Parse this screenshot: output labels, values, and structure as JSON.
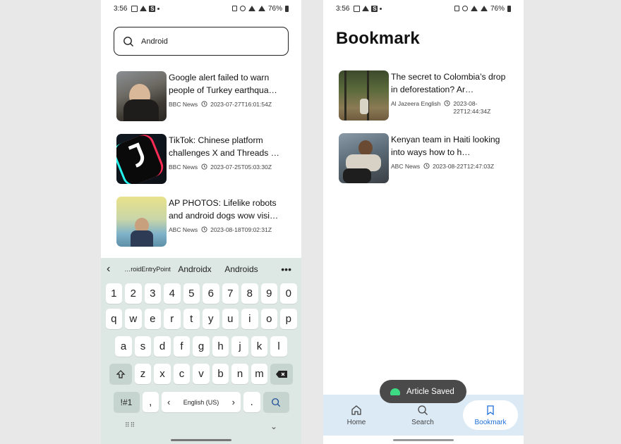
{
  "status_bar": {
    "time": "3:56",
    "battery": "76%"
  },
  "search_screen": {
    "query": "Android",
    "results": [
      {
        "title": "Google alert failed to warn people of Turkey earthqua…",
        "source": "BBC News",
        "date": "2023-07-27T16:01:54Z"
      },
      {
        "title": "TikTok: Chinese platform challenges X and Threads …",
        "source": "BBC News",
        "date": "2023-07-25T05:03:30Z"
      },
      {
        "title": "AP PHOTOS: Lifelike robots and android dogs wow visi…",
        "source": "ABC News",
        "date": "2023-08-18T09:02:31Z"
      }
    ],
    "keyboard": {
      "suggestions": [
        "…roidEntryPoint",
        "Androidx",
        "Androids"
      ],
      "row_numbers": [
        "1",
        "2",
        "3",
        "4",
        "5",
        "6",
        "7",
        "8",
        "9",
        "0"
      ],
      "row1": [
        "q",
        "w",
        "e",
        "r",
        "t",
        "y",
        "u",
        "i",
        "o",
        "p"
      ],
      "row2": [
        "a",
        "s",
        "d",
        "f",
        "g",
        "h",
        "j",
        "k",
        "l"
      ],
      "row3": [
        "z",
        "x",
        "c",
        "v",
        "b",
        "n",
        "m"
      ],
      "symbols_label": "!#1",
      "comma": ",",
      "space_label": "English (US)",
      "period": "."
    }
  },
  "bookmark_screen": {
    "title": "Bookmark",
    "articles": [
      {
        "title": "The secret to Colombia’s drop in deforestation? Ar…",
        "source": "Al Jazeera English",
        "date": "2023-08-22T12:44:34Z"
      },
      {
        "title": "Kenyan team in Haiti looking into ways how to h…",
        "source": "ABC News",
        "date": "2023-08-22T12:47:03Z"
      }
    ],
    "toast": "Article Saved",
    "nav": {
      "home": "Home",
      "search": "Search",
      "bookmark": "Bookmark"
    },
    "accent_color": "#1e6fd9"
  }
}
